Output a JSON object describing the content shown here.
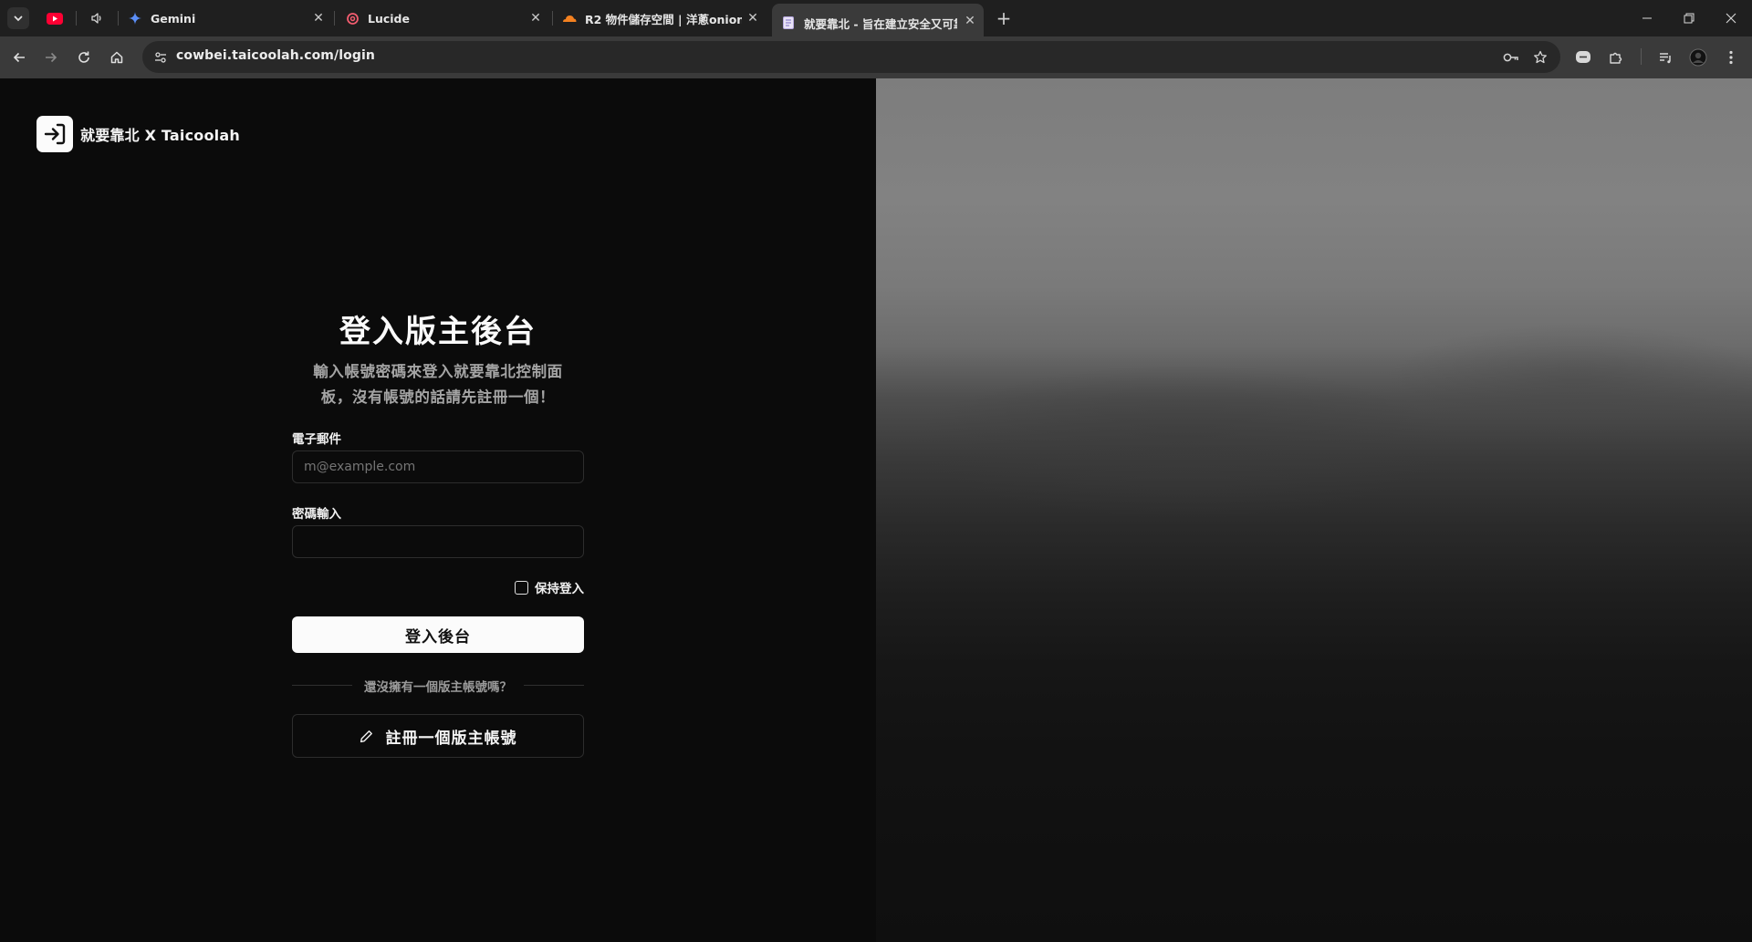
{
  "browser": {
    "tabs": [
      {
        "title": "Gemini",
        "favicon": "gemini-sparkle-icon"
      },
      {
        "title": "Lucide",
        "favicon": "lucide-icon"
      },
      {
        "title": "R2 物件儲存空間 | 洋蔥onion",
        "favicon": "cloudflare-icon"
      },
      {
        "title": "就要靠北 - 旨在建立安全又可靠",
        "favicon": "page-doc-icon",
        "active": true
      }
    ],
    "pinned": [
      "youtube-icon",
      "speaker-icon"
    ],
    "url": "cowbei.taicoolah.com/login"
  },
  "colors": {
    "chrome_tabbar": "#1f1f1f",
    "chrome_toolbar": "#3a3a3a",
    "page_bg": "#0b0b0b",
    "primary_button": "#fbfbfb"
  },
  "brand": {
    "name": "就要靠北 X Taicoolah",
    "logo_icon": "log-in-icon"
  },
  "login": {
    "heading": "登入版主後台",
    "subtitle": "輸入帳號密碼來登入就要靠北控制面板，沒有帳號的話請先註冊一個！",
    "email_label": "電子郵件",
    "email_placeholder": "m@example.com",
    "email_value": "",
    "password_label": "密碼輸入",
    "password_value": "",
    "keep_signed_in_label": "保持登入",
    "keep_signed_in_checked": false,
    "submit_label": "登入後台",
    "divider_text": "還沒擁有一個版主帳號嗎？",
    "register_label": "註冊一個版主帳號",
    "register_icon": "pencil-icon"
  }
}
